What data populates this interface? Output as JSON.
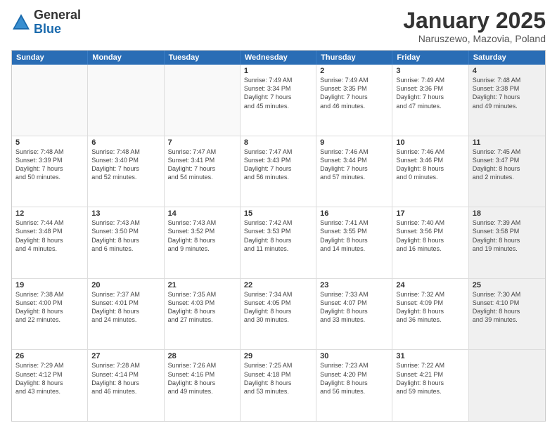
{
  "header": {
    "logo_general": "General",
    "logo_blue": "Blue",
    "title": "January 2025",
    "subtitle": "Naruszewo, Mazovia, Poland"
  },
  "days_of_week": [
    "Sunday",
    "Monday",
    "Tuesday",
    "Wednesday",
    "Thursday",
    "Friday",
    "Saturday"
  ],
  "rows": [
    [
      {
        "day": "",
        "text": "",
        "empty": true
      },
      {
        "day": "",
        "text": "",
        "empty": true
      },
      {
        "day": "",
        "text": "",
        "empty": true
      },
      {
        "day": "1",
        "text": "Sunrise: 7:49 AM\nSunset: 3:34 PM\nDaylight: 7 hours\nand 45 minutes."
      },
      {
        "day": "2",
        "text": "Sunrise: 7:49 AM\nSunset: 3:35 PM\nDaylight: 7 hours\nand 46 minutes."
      },
      {
        "day": "3",
        "text": "Sunrise: 7:49 AM\nSunset: 3:36 PM\nDaylight: 7 hours\nand 47 minutes."
      },
      {
        "day": "4",
        "text": "Sunrise: 7:48 AM\nSunset: 3:38 PM\nDaylight: 7 hours\nand 49 minutes.",
        "shaded": true
      }
    ],
    [
      {
        "day": "5",
        "text": "Sunrise: 7:48 AM\nSunset: 3:39 PM\nDaylight: 7 hours\nand 50 minutes."
      },
      {
        "day": "6",
        "text": "Sunrise: 7:48 AM\nSunset: 3:40 PM\nDaylight: 7 hours\nand 52 minutes."
      },
      {
        "day": "7",
        "text": "Sunrise: 7:47 AM\nSunset: 3:41 PM\nDaylight: 7 hours\nand 54 minutes."
      },
      {
        "day": "8",
        "text": "Sunrise: 7:47 AM\nSunset: 3:43 PM\nDaylight: 7 hours\nand 56 minutes."
      },
      {
        "day": "9",
        "text": "Sunrise: 7:46 AM\nSunset: 3:44 PM\nDaylight: 7 hours\nand 57 minutes."
      },
      {
        "day": "10",
        "text": "Sunrise: 7:46 AM\nSunset: 3:46 PM\nDaylight: 8 hours\nand 0 minutes."
      },
      {
        "day": "11",
        "text": "Sunrise: 7:45 AM\nSunset: 3:47 PM\nDaylight: 8 hours\nand 2 minutes.",
        "shaded": true
      }
    ],
    [
      {
        "day": "12",
        "text": "Sunrise: 7:44 AM\nSunset: 3:48 PM\nDaylight: 8 hours\nand 4 minutes."
      },
      {
        "day": "13",
        "text": "Sunrise: 7:43 AM\nSunset: 3:50 PM\nDaylight: 8 hours\nand 6 minutes."
      },
      {
        "day": "14",
        "text": "Sunrise: 7:43 AM\nSunset: 3:52 PM\nDaylight: 8 hours\nand 9 minutes."
      },
      {
        "day": "15",
        "text": "Sunrise: 7:42 AM\nSunset: 3:53 PM\nDaylight: 8 hours\nand 11 minutes."
      },
      {
        "day": "16",
        "text": "Sunrise: 7:41 AM\nSunset: 3:55 PM\nDaylight: 8 hours\nand 14 minutes."
      },
      {
        "day": "17",
        "text": "Sunrise: 7:40 AM\nSunset: 3:56 PM\nDaylight: 8 hours\nand 16 minutes."
      },
      {
        "day": "18",
        "text": "Sunrise: 7:39 AM\nSunset: 3:58 PM\nDaylight: 8 hours\nand 19 minutes.",
        "shaded": true
      }
    ],
    [
      {
        "day": "19",
        "text": "Sunrise: 7:38 AM\nSunset: 4:00 PM\nDaylight: 8 hours\nand 22 minutes."
      },
      {
        "day": "20",
        "text": "Sunrise: 7:37 AM\nSunset: 4:01 PM\nDaylight: 8 hours\nand 24 minutes."
      },
      {
        "day": "21",
        "text": "Sunrise: 7:35 AM\nSunset: 4:03 PM\nDaylight: 8 hours\nand 27 minutes."
      },
      {
        "day": "22",
        "text": "Sunrise: 7:34 AM\nSunset: 4:05 PM\nDaylight: 8 hours\nand 30 minutes."
      },
      {
        "day": "23",
        "text": "Sunrise: 7:33 AM\nSunset: 4:07 PM\nDaylight: 8 hours\nand 33 minutes."
      },
      {
        "day": "24",
        "text": "Sunrise: 7:32 AM\nSunset: 4:09 PM\nDaylight: 8 hours\nand 36 minutes."
      },
      {
        "day": "25",
        "text": "Sunrise: 7:30 AM\nSunset: 4:10 PM\nDaylight: 8 hours\nand 39 minutes.",
        "shaded": true
      }
    ],
    [
      {
        "day": "26",
        "text": "Sunrise: 7:29 AM\nSunset: 4:12 PM\nDaylight: 8 hours\nand 43 minutes."
      },
      {
        "day": "27",
        "text": "Sunrise: 7:28 AM\nSunset: 4:14 PM\nDaylight: 8 hours\nand 46 minutes."
      },
      {
        "day": "28",
        "text": "Sunrise: 7:26 AM\nSunset: 4:16 PM\nDaylight: 8 hours\nand 49 minutes."
      },
      {
        "day": "29",
        "text": "Sunrise: 7:25 AM\nSunset: 4:18 PM\nDaylight: 8 hours\nand 53 minutes."
      },
      {
        "day": "30",
        "text": "Sunrise: 7:23 AM\nSunset: 4:20 PM\nDaylight: 8 hours\nand 56 minutes."
      },
      {
        "day": "31",
        "text": "Sunrise: 7:22 AM\nSunset: 4:21 PM\nDaylight: 8 hours\nand 59 minutes."
      },
      {
        "day": "",
        "text": "",
        "empty": true,
        "shaded": true
      }
    ]
  ]
}
